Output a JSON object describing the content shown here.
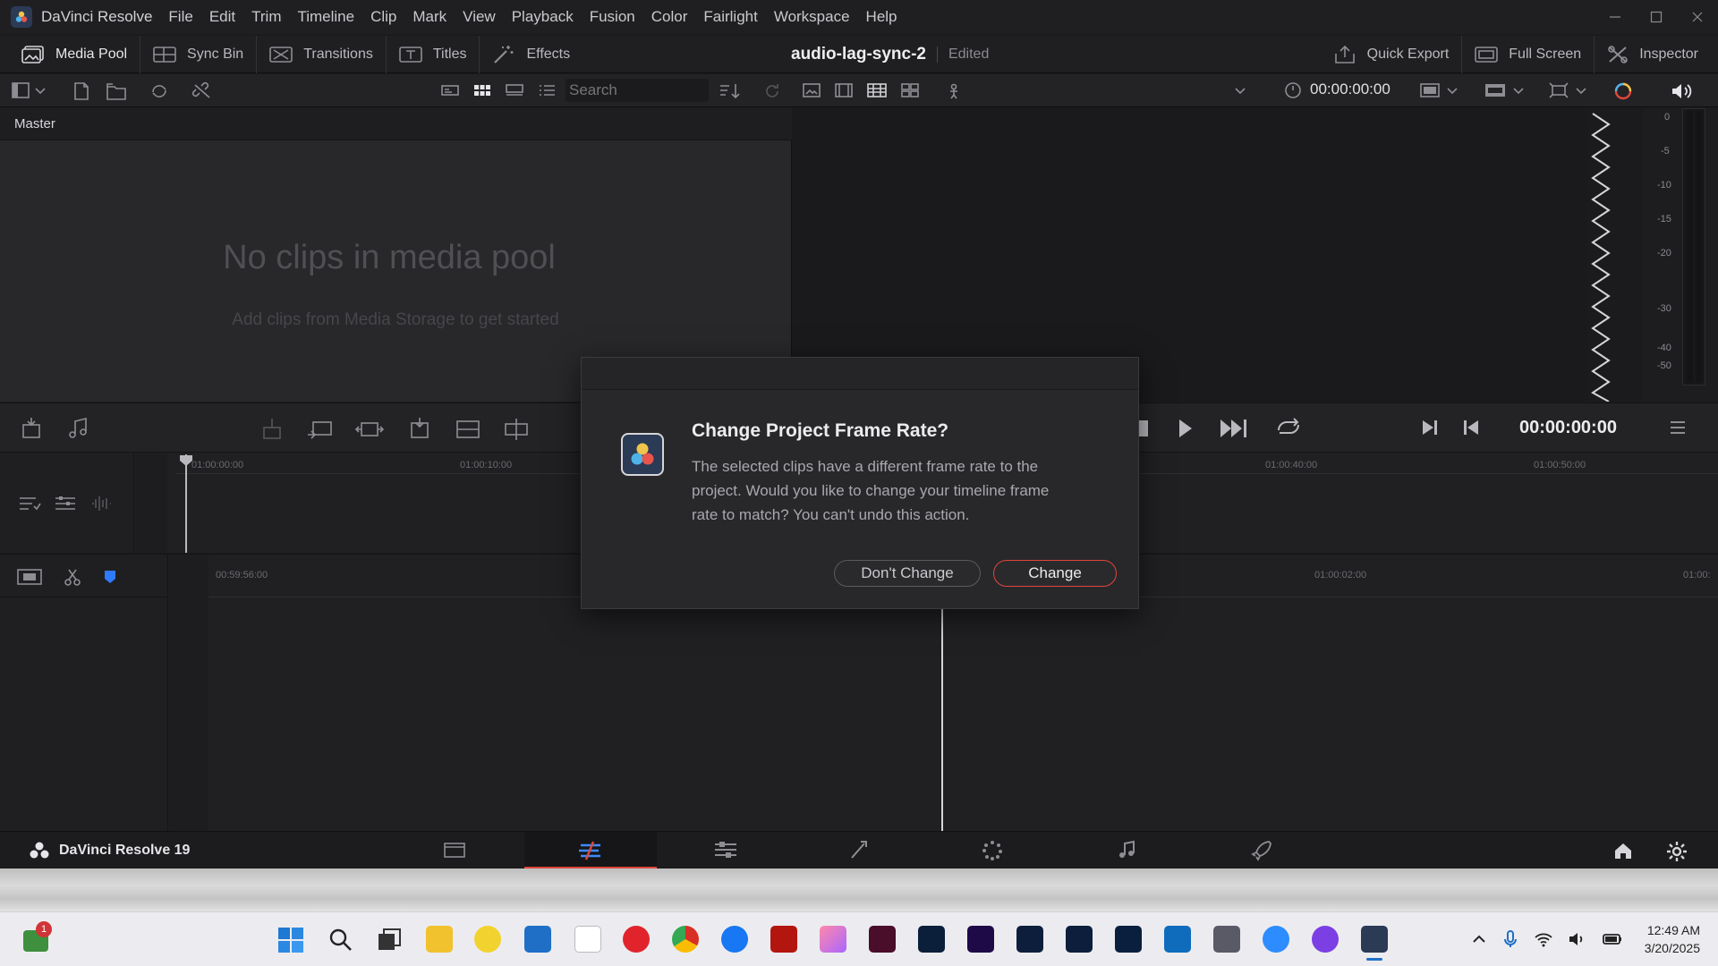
{
  "menu": {
    "app_name": "DaVinci Resolve",
    "items": [
      "File",
      "Edit",
      "Trim",
      "Timeline",
      "Clip",
      "Mark",
      "View",
      "Playback",
      "Fusion",
      "Color",
      "Fairlight",
      "Workspace",
      "Help"
    ]
  },
  "toolbar": {
    "media_pool": "Media Pool",
    "sync_bin": "Sync Bin",
    "transitions": "Transitions",
    "titles": "Titles",
    "effects": "Effects",
    "project_name": "audio-lag-sync-2",
    "project_status": "Edited",
    "quick_export": "Quick Export",
    "full_screen": "Full Screen",
    "inspector": "Inspector"
  },
  "subbar": {
    "search_placeholder": "Search",
    "viewer_timecode": "00:00:00:00"
  },
  "media_pool": {
    "bin": "Master",
    "empty_title": "No clips in media pool",
    "empty_hint": "Add clips from Media Storage to get started"
  },
  "meters": {
    "scale": [
      "0",
      "-5",
      "-10",
      "-15",
      "-20",
      "-30",
      "-40",
      "-50"
    ]
  },
  "transport": {
    "timecode": "00:00:00:00"
  },
  "timeline": {
    "upper_ticks": [
      "01:00:00:00",
      "01:00:10:00",
      "01:00:40:00",
      "01:00:50:00"
    ],
    "lower_ticks": [
      "00:59:56:00",
      "01:00:02:00",
      "01:00:"
    ]
  },
  "dialog": {
    "title": "Change Project Frame Rate?",
    "message": "The selected clips have a different frame rate to the project. Would you like to change your timeline frame rate to match? You can't undo this action.",
    "dont_change": "Don't Change",
    "change": "Change"
  },
  "pagebar": {
    "brand": "DaVinci Resolve 19"
  },
  "taskbar": {
    "badge_count": "1",
    "time": "12:49 AM",
    "date": "3/20/2025"
  },
  "colors": {
    "accent_red": "#e0473a",
    "highlight_blue": "#2f7bff"
  }
}
